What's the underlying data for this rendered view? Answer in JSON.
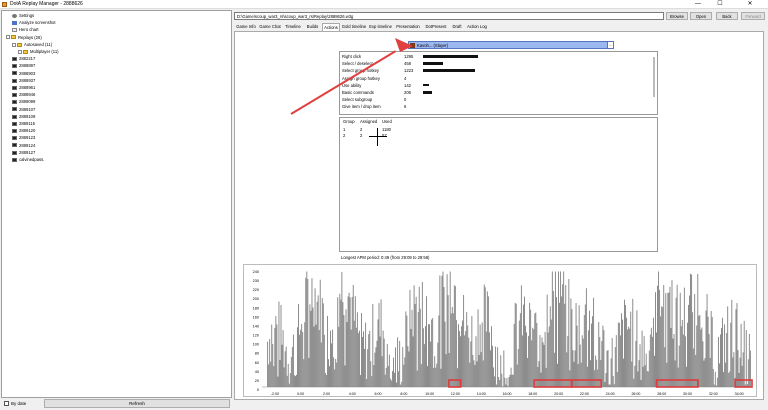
{
  "window": {
    "title": "DotA Replay Manager - 2888626",
    "minimize": "—",
    "maximize": "☐",
    "close": "✕"
  },
  "tree": {
    "items": [
      {
        "label": "Settings",
        "icon": "gear-icon",
        "indent": 1
      },
      {
        "label": "Analyze screenshot",
        "icon": "chart-icon",
        "indent": 1
      },
      {
        "label": "Hero chart",
        "icon": "doc-icon",
        "indent": 1
      },
      {
        "label": "Replays (26)",
        "icon": "folder-icon",
        "indent": 0
      },
      {
        "label": "Autosaved (11)",
        "icon": "folder-icon",
        "indent": 1
      },
      {
        "label": "Multiplayer (11)",
        "icon": "folder-icon",
        "indent": 2
      },
      {
        "label": "2882217",
        "icon": "replay-icon",
        "indent": 1
      },
      {
        "label": "2888897",
        "icon": "replay-icon",
        "indent": 1
      },
      {
        "label": "2888903",
        "icon": "replay-icon",
        "indent": 1
      },
      {
        "label": "2888937",
        "icon": "replay-icon",
        "indent": 1
      },
      {
        "label": "2888961",
        "icon": "replay-icon",
        "indent": 1
      },
      {
        "label": "2888946",
        "icon": "replay-icon",
        "indent": 1
      },
      {
        "label": "2889099",
        "icon": "replay-icon",
        "indent": 1
      },
      {
        "label": "2889107",
        "icon": "replay-icon",
        "indent": 1
      },
      {
        "label": "2889109",
        "icon": "replay-icon",
        "indent": 1
      },
      {
        "label": "2889115",
        "icon": "replay-icon",
        "indent": 1
      },
      {
        "label": "2889120",
        "icon": "replay-icon",
        "indent": 1
      },
      {
        "label": "2889123",
        "icon": "replay-icon",
        "indent": 1
      },
      {
        "label": "2889124",
        "icon": "replay-icon",
        "indent": 1
      },
      {
        "label": "2889127",
        "icon": "replay-icon",
        "indent": 1
      },
      {
        "label": "calvinedpass.",
        "icon": "replay-icon",
        "indent": 1
      }
    ]
  },
  "bottom": {
    "by_date": "By date",
    "refresh": "Refresh"
  },
  "toolbar": {
    "path": "D:\\Game\\scoup_war3_rs\\scoup_war3_rs\\Replay\\2888626.w3g",
    "browse": "Browse",
    "open": "Open",
    "back": "Back",
    "forward": "Forward"
  },
  "tabs": [
    "Game Info",
    "Game Chat",
    "Timeline",
    "Builds",
    "Actions",
    "Gold timeline",
    "Exp timeline",
    "Presentation",
    "DotPresent",
    "Draft",
    "Action Log"
  ],
  "active_tab": "Actions",
  "player_select": {
    "value": "Kavoh... (Slayer)",
    "arrow": "..."
  },
  "stats": [
    {
      "label": "Right click",
      "value": "1295",
      "frac": 0.95
    },
    {
      "label": "Select / deselect",
      "value": "458",
      "frac": 0.34
    },
    {
      "label": "Select group hotkey",
      "value": "1223",
      "frac": 0.9
    },
    {
      "label": "Assign group hotkey",
      "value": "4",
      "frac": 0.0
    },
    {
      "label": "Use ability",
      "value": "142",
      "frac": 0.1
    },
    {
      "label": "Basic commands",
      "value": "206",
      "frac": 0.15
    },
    {
      "label": "Select subgroup",
      "value": "0",
      "frac": 0.0
    },
    {
      "label": "Give item / drop item",
      "value": "6",
      "frac": 0.0
    }
  ],
  "groups": {
    "headers": [
      "Group",
      "Assigned",
      "Used"
    ],
    "rows": [
      [
        "1",
        "2",
        "1180"
      ],
      [
        "2",
        "2",
        "57"
      ]
    ]
  },
  "apm_period": "Longest APM period: 0:49 (from 29:09 to 29:58)",
  "chart_data": {
    "type": "bar",
    "title": "",
    "xlabel": "",
    "ylabel": "",
    "ylim": [
      0,
      240
    ],
    "yticks": [
      "240",
      "230",
      "220",
      "200",
      "180",
      "160",
      "140",
      "120",
      "100",
      "80",
      "60",
      "40",
      "20",
      "0"
    ],
    "xticks": [
      "-2:00",
      "0:00",
      "2:00",
      "4:00",
      "6:00",
      "8:00",
      "10:00",
      "12:00",
      "14:00",
      "16:00",
      "18:00",
      "20:00",
      "22:00",
      "24:00",
      "26:00",
      "28:00",
      "30:00",
      "32:00",
      "34:00"
    ],
    "xlim": [
      -3,
      35
    ],
    "bar_color": "#808080",
    "highlight_color": "#e03a3a",
    "highlights": [
      [
        11.5,
        12.4
      ],
      [
        18.1,
        21.0
      ],
      [
        21.0,
        23.3
      ],
      [
        27.6,
        30.8
      ],
      [
        33.7,
        35.0
      ]
    ]
  }
}
